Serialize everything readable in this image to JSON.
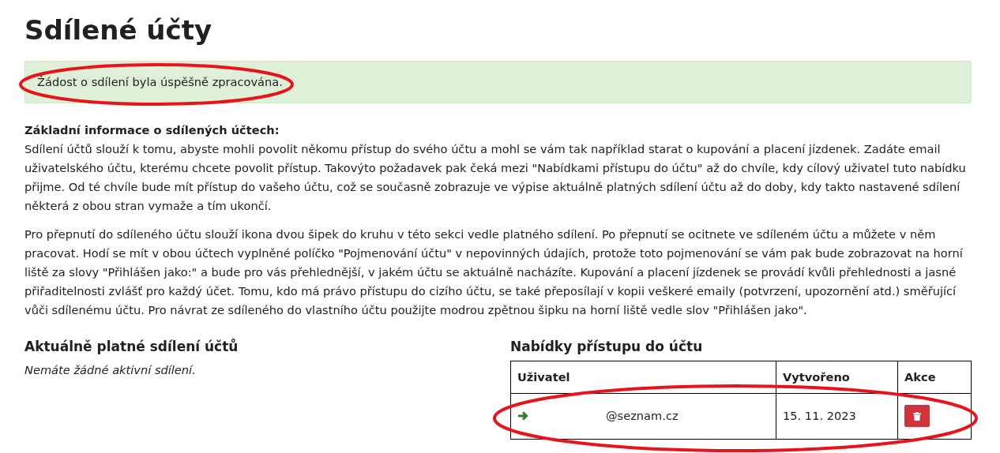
{
  "title": "Sdílené účty",
  "alert": {
    "text": "Žádost o sdílení byla úspěšně zpracována.",
    "circled": true
  },
  "info": {
    "heading": "Základní informace o sdílených účtech:",
    "paragraphs": [
      "Sdílení účtů slouží k tomu, abyste mohli povolit někomu přístup do svého účtu a mohl se vám tak například starat o kupování a placení jízdenek. Zadáte email uživatelského účtu, kterému chcete povolit přístup. Takovýto požadavek pak čeká mezi \"Nabídkami přístupu do účtu\" až do chvíle, kdy cílový uživatel tuto nabídku přijme. Od té chvíle bude mít přístup do vašeho účtu, což se současně zobrazuje ve výpise aktuálně platných sdílení účtu až do doby, kdy takto nastavené sdílení některá z obou stran vymaže a tím ukončí.",
      "Pro přepnutí do sdíleného účtu slouží ikona dvou šipek do kruhu v této sekci vedle platného sdílení. Po přepnutí se ocitnete ve sdíleném účtu a můžete v něm pracovat. Hodí se mít v obou účtech vyplněné políčko \"Pojmenování účtu\" v nepovinných údajích, protože toto pojmenování se vám pak bude zobrazovat na horní liště za slovy \"Přihlášen jako:\" a bude pro vás přehlednější, v jakém účtu se aktuálně nacházíte. Kupování a placení jízdenek se provádí kvůli přehlednosti a jasné přiřaditelnosti zvlášť pro každý účet. Tomu, kdo má právo přístupu do cizího účtu, se také přeposílají v kopii veškeré emaily (potvrzení, upozornění atd.) směřující vůči sdílenému účtu. Pro návrat ze sdíleného do vlastního účtu použijte modrou zpětnou šipku na horní liště vedle slov \"Přihlášen jako\"."
    ]
  },
  "active_shares": {
    "heading": "Aktuálně platné sdílení účtů",
    "empty_text": "Nemáte žádné aktivní sdílení."
  },
  "offers": {
    "heading": "Nabídky přístupu do účtu",
    "circled": true,
    "columns": [
      "Uživatel",
      "Vytvořeno",
      "Akce"
    ],
    "rows": [
      {
        "user": "@seznam.cz",
        "created": "15. 11. 2023"
      }
    ]
  }
}
